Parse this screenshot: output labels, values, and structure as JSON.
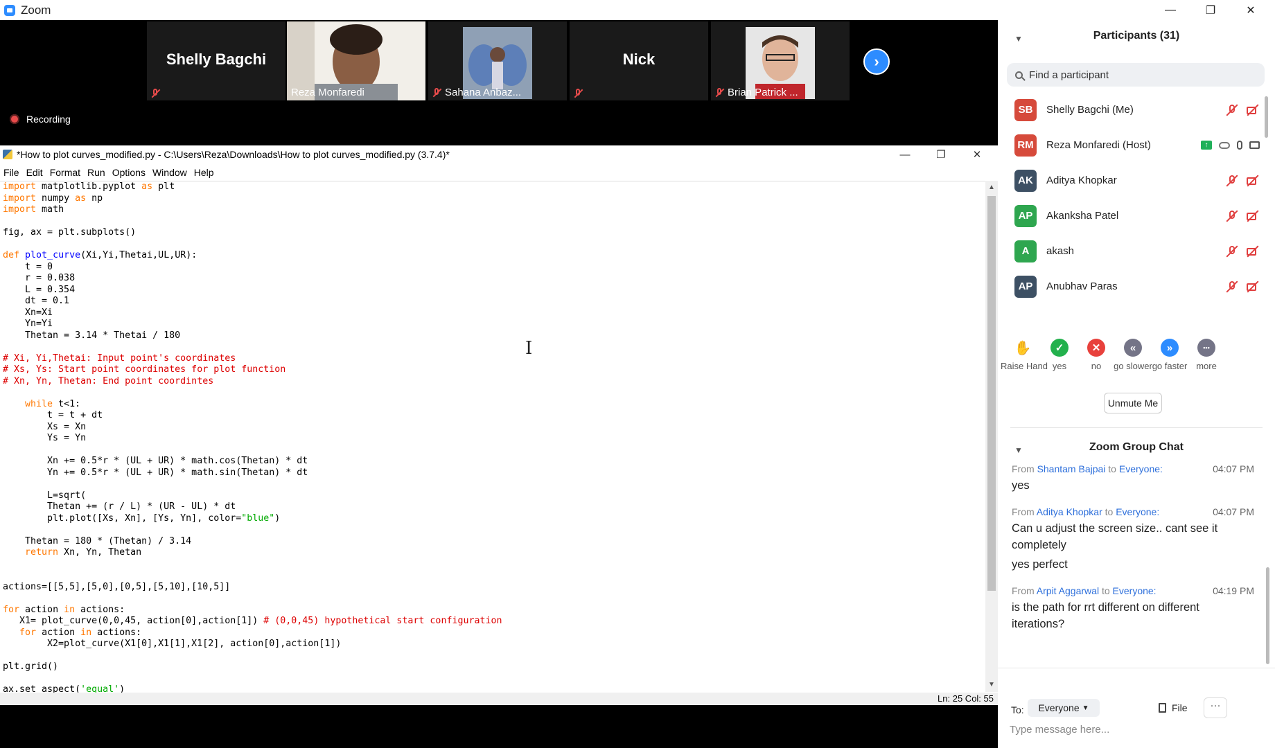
{
  "window": {
    "title": "Zoom",
    "minimize": "—",
    "restore": "❐",
    "close": "✕"
  },
  "gallery": {
    "tiles": [
      {
        "name": "Shelly Bagchi",
        "label": "",
        "mode": "name"
      },
      {
        "name": "Reza Monfaredi",
        "label": "Reza Monfaredi",
        "mode": "video"
      },
      {
        "name": "Sahana Anbaz...",
        "label": "Sahana Anbaz...",
        "mode": "video"
      },
      {
        "name": "Nick",
        "label": "",
        "mode": "name"
      },
      {
        "name": "Brian Patrick ...",
        "label": "Brian Patrick ...",
        "mode": "video"
      }
    ],
    "next_glyph": "›",
    "recording_label": "Recording"
  },
  "idle": {
    "title": "*How to plot curves_modified.py - C:\\Users\\Reza\\Downloads\\How to plot curves_modified.py (3.7.4)*",
    "menu": [
      "File",
      "Edit",
      "Format",
      "Run",
      "Options",
      "Window",
      "Help"
    ],
    "status": "Ln: 25  Col: 55",
    "code_lines": [
      [
        [
          "kw",
          "import"
        ],
        [
          "t",
          " matplotlib.pyplot "
        ],
        [
          "kw",
          "as"
        ],
        [
          "t",
          " plt"
        ]
      ],
      [
        [
          "kw",
          "import"
        ],
        [
          "t",
          " numpy "
        ],
        [
          "kw",
          "as"
        ],
        [
          "t",
          " np"
        ]
      ],
      [
        [
          "kw",
          "import"
        ],
        [
          "t",
          " math"
        ]
      ],
      [
        [
          "t",
          ""
        ]
      ],
      [
        [
          "t",
          "fig, ax = plt.subplots()"
        ]
      ],
      [
        [
          "t",
          ""
        ]
      ],
      [
        [
          "kw",
          "def"
        ],
        [
          "t",
          " "
        ],
        [
          "fn",
          "plot_curve"
        ],
        [
          "t",
          "(Xi,Yi,Thetai,UL,UR):"
        ]
      ],
      [
        [
          "t",
          "    t = 0"
        ]
      ],
      [
        [
          "t",
          "    r = 0.038"
        ]
      ],
      [
        [
          "t",
          "    L = 0.354"
        ]
      ],
      [
        [
          "t",
          "    dt = 0.1"
        ]
      ],
      [
        [
          "t",
          "    Xn=Xi"
        ]
      ],
      [
        [
          "t",
          "    Yn=Yi"
        ]
      ],
      [
        [
          "t",
          "    Thetan = 3.14 * Thetai / 180"
        ]
      ],
      [
        [
          "t",
          ""
        ]
      ],
      [
        [
          "cm",
          "# Xi, Yi,Thetai: Input point's coordinates"
        ]
      ],
      [
        [
          "cm",
          "# Xs, Ys: Start point coordinates for plot function"
        ]
      ],
      [
        [
          "cm",
          "# Xn, Yn, Thetan: End point coordintes"
        ]
      ],
      [
        [
          "t",
          ""
        ]
      ],
      [
        [
          "t",
          "    "
        ],
        [
          "kw",
          "while"
        ],
        [
          "t",
          " t<1:"
        ]
      ],
      [
        [
          "t",
          "        t = t + dt"
        ]
      ],
      [
        [
          "t",
          "        Xs = Xn"
        ]
      ],
      [
        [
          "t",
          "        Ys = Yn"
        ]
      ],
      [
        [
          "t",
          ""
        ]
      ],
      [
        [
          "t",
          "        Xn += 0.5*r * (UL + UR) * math.cos(Thetan) * dt"
        ]
      ],
      [
        [
          "t",
          "        Yn += 0.5*r * (UL + UR) * math.sin(Thetan) * dt"
        ]
      ],
      [
        [
          "t",
          ""
        ]
      ],
      [
        [
          "t",
          "        L=sqrt("
        ]
      ],
      [
        [
          "t",
          "        Thetan += (r / L) * (UR - UL) * dt"
        ]
      ],
      [
        [
          "t",
          "        plt.plot([Xs, Xn], [Ys, Yn], color="
        ],
        [
          "str",
          "\"blue\""
        ],
        [
          "t",
          ")"
        ]
      ],
      [
        [
          "t",
          ""
        ]
      ],
      [
        [
          "t",
          "    Thetan = 180 * (Thetan) / 3.14"
        ]
      ],
      [
        [
          "t",
          "    "
        ],
        [
          "kw",
          "return"
        ],
        [
          "t",
          " Xn, Yn, Thetan"
        ]
      ],
      [
        [
          "t",
          ""
        ]
      ],
      [
        [
          "t",
          ""
        ]
      ],
      [
        [
          "t",
          "actions=[[5,5],[5,0],[0,5],[5,10],[10,5]]"
        ]
      ],
      [
        [
          "t",
          ""
        ]
      ],
      [
        [
          "kw",
          "for"
        ],
        [
          "t",
          " action "
        ],
        [
          "kw",
          "in"
        ],
        [
          "t",
          " actions:"
        ]
      ],
      [
        [
          "t",
          "   X1= plot_curve(0,0,45, action[0],action[1]) "
        ],
        [
          "cm",
          "# (0,0,45) hypothetical start configuration"
        ]
      ],
      [
        [
          "t",
          "   "
        ],
        [
          "kw",
          "for"
        ],
        [
          "t",
          " action "
        ],
        [
          "kw",
          "in"
        ],
        [
          "t",
          " actions:"
        ]
      ],
      [
        [
          "t",
          "        X2=plot_curve(X1[0],X1[1],X1[2], action[0],action[1])"
        ]
      ],
      [
        [
          "t",
          ""
        ]
      ],
      [
        [
          "t",
          "plt.grid()"
        ]
      ],
      [
        [
          "t",
          ""
        ]
      ],
      [
        [
          "t",
          "ax.set_aspect("
        ],
        [
          "str",
          "'equal'"
        ],
        [
          "t",
          ")"
        ]
      ]
    ]
  },
  "panel": {
    "participants_title": "Participants (31)",
    "search_placeholder": "Find a participant",
    "participants": [
      {
        "initials": "SB",
        "name": "Shelly Bagchi (Me)",
        "color": "#d64a3b",
        "host": false
      },
      {
        "initials": "RM",
        "name": "Reza Monfaredi (Host)",
        "color": "#d64a3b",
        "host": true
      },
      {
        "initials": "AK",
        "name": "Aditya Khopkar",
        "color": "#3d5064",
        "host": false
      },
      {
        "initials": "AP",
        "name": "Akanksha Patel",
        "color": "#2ea64f",
        "host": false
      },
      {
        "initials": "A",
        "name": "akash",
        "color": "#2ea64f",
        "host": false
      },
      {
        "initials": "AP",
        "name": "Anubhav Paras",
        "color": "#3d5064",
        "host": false
      }
    ],
    "reactions": [
      {
        "label": "Raise Hand",
        "glyph": "✋",
        "color": "#ffffff",
        "fg": "#2d8cff"
      },
      {
        "label": "yes",
        "glyph": "✓",
        "color": "#23b14d",
        "fg": "#ffffff"
      },
      {
        "label": "no",
        "glyph": "✕",
        "color": "#e8413c",
        "fg": "#ffffff"
      },
      {
        "label": "go slower",
        "glyph": "«",
        "color": "#747487",
        "fg": "#ffffff"
      },
      {
        "label": "go faster",
        "glyph": "»",
        "color": "#2d8cff",
        "fg": "#ffffff"
      },
      {
        "label": "more",
        "glyph": "•••",
        "color": "#747487",
        "fg": "#ffffff"
      }
    ],
    "unmute_label": "Unmute Me",
    "chat_title": "Zoom Group Chat",
    "messages": [
      {
        "from_prefix": "From",
        "from": "Shantam Bajpai",
        "to_prefix": "to",
        "to": "Everyone:",
        "time": "04:07 PM",
        "lines": [
          "yes"
        ]
      },
      {
        "from_prefix": "From",
        "from": "Aditya Khopkar",
        "to_prefix": "to",
        "to": "Everyone:",
        "time": "04:07 PM",
        "lines": [
          "Can u adjust the screen size.. cant see it completely",
          "yes perfect"
        ]
      },
      {
        "from_prefix": "From",
        "from": "Arpit Aggarwal",
        "to_prefix": "to",
        "to": "Everyone:",
        "time": "04:19 PM",
        "lines": [
          "is the path for rrt different on different iterations?"
        ]
      }
    ],
    "to_label": "To:",
    "to_value": "Everyone",
    "file_label": "File",
    "more_label": "···",
    "message_placeholder": "Type message here..."
  },
  "colors": {
    "kw": "#ff7700",
    "fn": "#0000ff",
    "str": "#00aa00",
    "cm": "#dd0000",
    "link": "#2d6fdb"
  }
}
